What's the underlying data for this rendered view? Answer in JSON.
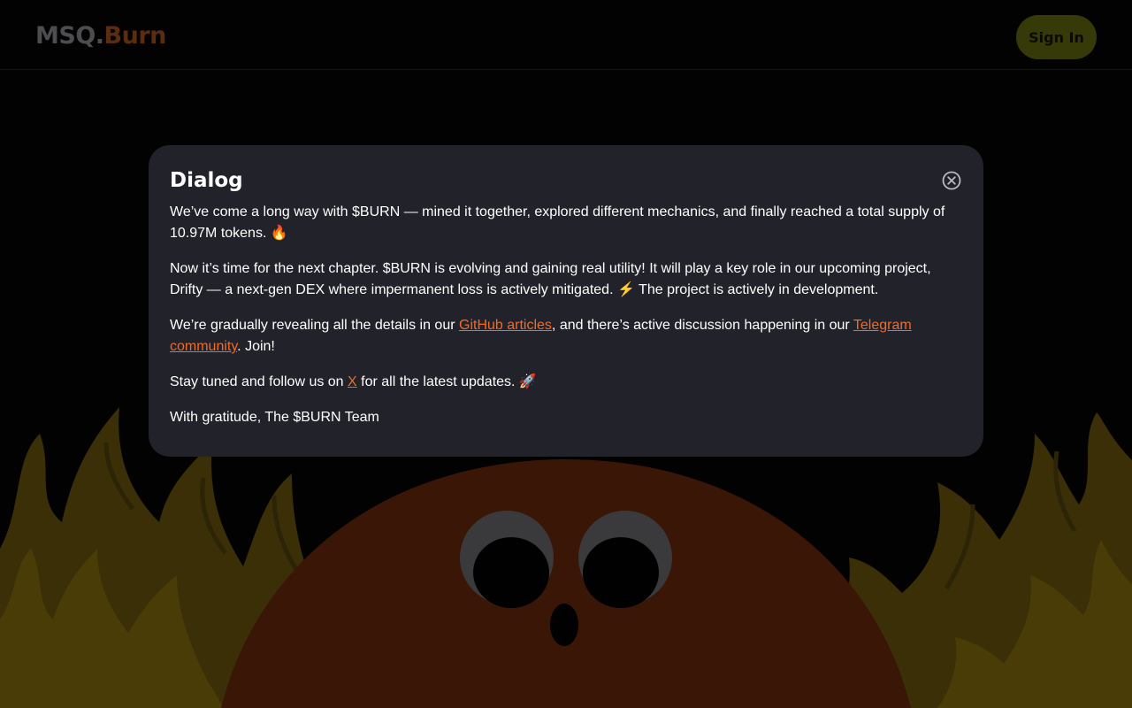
{
  "header": {
    "logo_part1": "MSQ.",
    "logo_part2": "Burn",
    "signin_label": "Sign In"
  },
  "dialog": {
    "title": "Dialog",
    "close_icon": "close-circle-icon",
    "p1": "We’ve come a long way with $BURN — mined it together, explored different mechanics, and finally reached a total supply of 10.97M tokens. 🔥",
    "p2": "Now it’s time for the next chapter. $BURN is evolving and gaining real utility! It will play a key role in our upcoming project, Drifty — a next-gen DEX where impermanent loss is actively mitigated. ⚡ The project is actively in development.",
    "p3_before": "We’re gradually revealing all the details in our ",
    "p3_link1": "GitHub articles",
    "p3_middle": ", and there’s active discussion happening in our ",
    "p3_link2": "Telegram community",
    "p3_after": ". Join!",
    "p4_before": "Stay tuned and follow us on ",
    "p4_link": "X",
    "p4_after": " for all the latest updates. 🚀",
    "p5": "With gratitude, The $BURN Team"
  },
  "colors": {
    "background": "#020203",
    "dialog_bg": "#22222a",
    "link": "#f26a25",
    "signin_bg": "#363a08",
    "flame": "#3e3206",
    "mascot": "#3a1607"
  },
  "icons": [
    "fire-icon",
    "lightning-icon",
    "rocket-icon",
    "close-circle-icon"
  ]
}
